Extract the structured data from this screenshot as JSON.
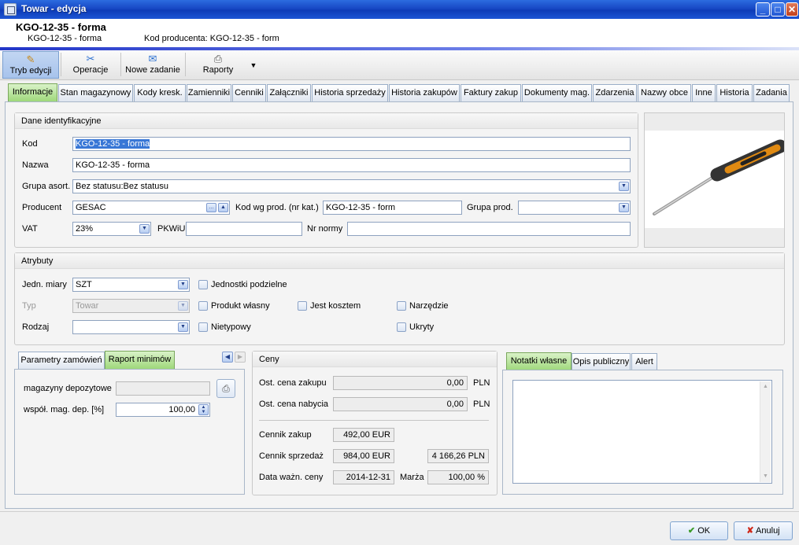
{
  "window": {
    "title": "Towar - edycja"
  },
  "header": {
    "title": "KGO-12-35 - forma",
    "code": "KGO-12-35 - forma",
    "producer_code_label": "Kod producenta: KGO-12-35 - form"
  },
  "toolbar": {
    "edit": "Tryb edycji",
    "operations": "Operacje",
    "new_task": "Nowe zadanie",
    "reports": "Raporty"
  },
  "tabs": [
    "Informacje",
    "Stan magazynowy",
    "Kody kresk.",
    "Zamienniki",
    "Cenniki",
    "Załączniki",
    "Historia sprzedaży",
    "Historia zakupów",
    "Faktury zakup",
    "Dokumenty mag.",
    "Zdarzenia",
    "Nazwy obce",
    "Inne",
    "Historia",
    "Zadania"
  ],
  "ident": {
    "title": "Dane identyfikacyjne",
    "kod_label": "Kod",
    "kod_value": "KGO-12-35 - forma",
    "nazwa_label": "Nazwa",
    "nazwa_value": "KGO-12-35 - forma",
    "grupa_label": "Grupa asort.",
    "grupa_value": "Bez statusu:Bez statusu",
    "producent_label": "Producent",
    "producent_value": "GESAC",
    "kodwg_label": "Kod wg prod. (nr kat.)",
    "kodwg_value": "KGO-12-35 - form",
    "grupaprod_label": "Grupa prod.",
    "grupaprod_value": "",
    "vat_label": "VAT",
    "vat_value": "23%",
    "pkwiu_label": "PKWiU",
    "pkwiu_value": "",
    "nrnormy_label": "Nr normy",
    "nrnormy_value": ""
  },
  "attrs": {
    "title": "Atrybuty",
    "jm_label": "Jedn. miary",
    "jm_value": "SZT",
    "typ_label": "Typ",
    "typ_value": "Towar",
    "rodzaj_label": "Rodzaj",
    "rodzaj_value": "",
    "jednostki": "Jednostki podzielne",
    "produkt": "Produkt własny",
    "nietypowy": "Nietypowy",
    "koszt": "Jest kosztem",
    "narzedzie": "Narzędzie",
    "ukryty": "Ukryty"
  },
  "left_tabs": {
    "params": "Parametry zamówień",
    "report": "Raport minimów"
  },
  "minimums": {
    "depot_label": "magazyny depozytowe",
    "depot_value": "",
    "factor_label": "współ. mag. dep. [%]",
    "factor_value": "100,00"
  },
  "prices": {
    "title": "Ceny",
    "last_purchase_label": "Ost. cena zakupu",
    "last_purchase_value": "0,00",
    "last_purchase_cur": "PLN",
    "last_acq_label": "Ost. cena nabycia",
    "last_acq_value": "0,00",
    "last_acq_cur": "PLN",
    "list_purchase_label": "Cennik zakup",
    "list_purchase_value": "492,00 EUR",
    "list_sale_label": "Cennik sprzedaż",
    "list_sale_value": "984,00 EUR",
    "list_sale_pln": "4 166,26 PLN",
    "valid_label": "Data ważn. ceny",
    "valid_value": "2014-12-31",
    "margin_label": "Marża",
    "margin_value": "100,00 %"
  },
  "notes_tabs": {
    "own": "Notatki własne",
    "public": "Opis publiczny",
    "alert": "Alert"
  },
  "footer": {
    "ok": "OK",
    "cancel": "Anuluj"
  }
}
